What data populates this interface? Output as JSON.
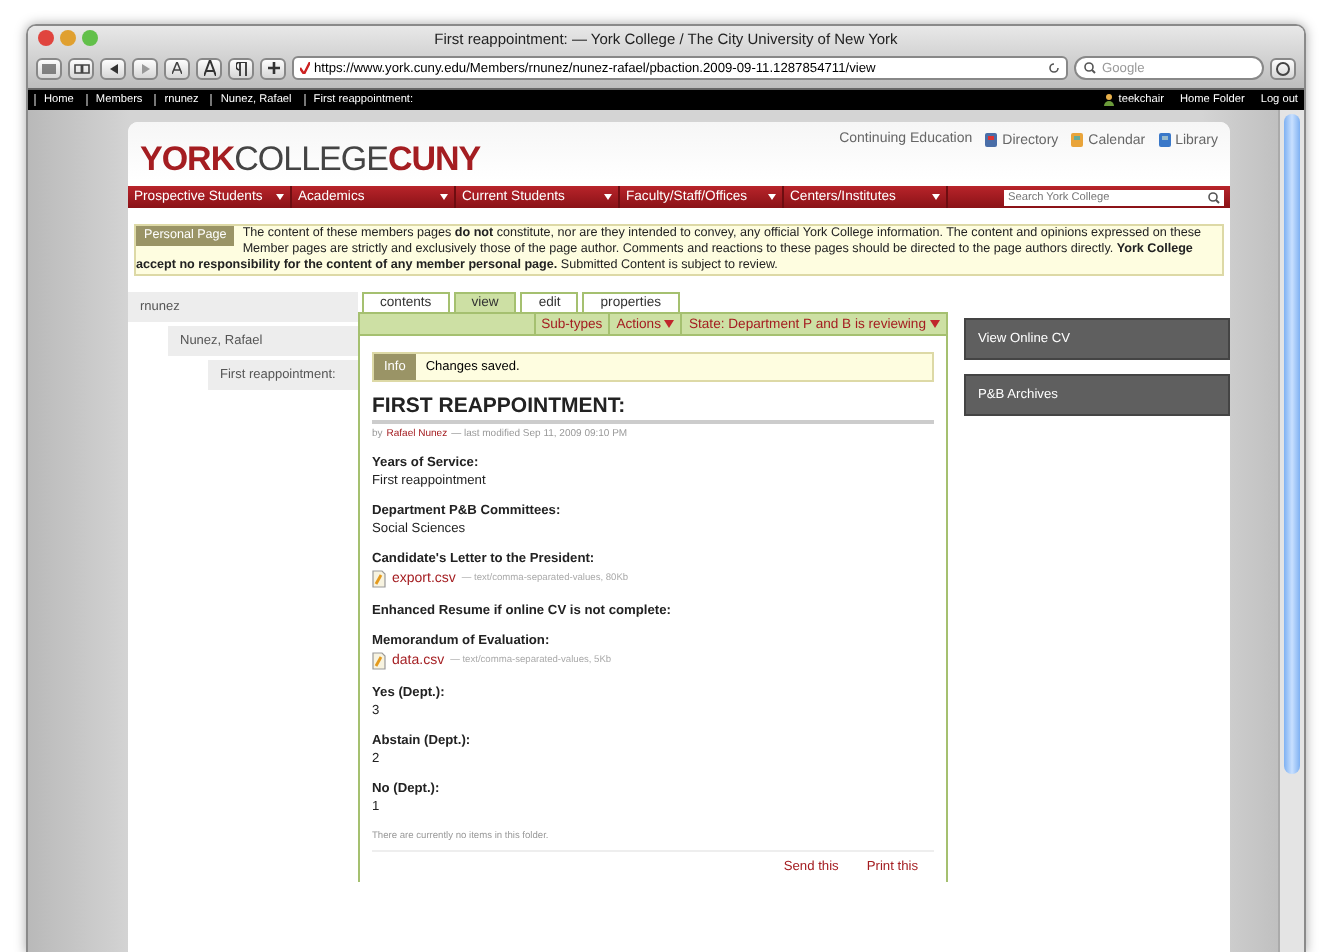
{
  "window": {
    "title": "First reappointment: — York College / The City University of New York"
  },
  "toolbar": {
    "url": "https://www.york.cuny.edu/Members/rnunez/nunez-rafael/pbaction.2009-09-11.1287854711/view",
    "search_placeholder": "Google"
  },
  "breadcrumbs": [
    "Home",
    "Members",
    "rnunez",
    "Nunez, Rafael",
    "First reappointment:"
  ],
  "user_links": [
    "teekchair",
    "Home Folder",
    "Log out"
  ],
  "site": {
    "logo": [
      {
        "text": "YORK",
        "accent": true
      },
      {
        "text": "COLLEGE",
        "accent": false
      },
      {
        "text": "CUNY",
        "accent": true
      }
    ],
    "top_links": [
      {
        "label": "Continuing Education",
        "kind": "plain"
      },
      {
        "label": "Directory",
        "kind": "directory"
      },
      {
        "label": "Calendar",
        "kind": "calendar"
      },
      {
        "label": "Library",
        "kind": "library"
      }
    ],
    "nav": [
      "Prospective Students",
      "Academics",
      "Current Students",
      "Faculty/Staff/Offices",
      "Centers/Institutes"
    ],
    "search_placeholder": "Search York College"
  },
  "notice": {
    "badge": "Personal Page",
    "text": "The content of these members pages **do not** constitute, nor are they intended to convey, any official York College information. The content and opinions expressed on these Member pages are strictly and exclusively those of the page author. Comments and reactions to these pages should be directed to the page authors directly. **York College accept no responsibility for the content of any member personal page.** Submitted Content is subject to review."
  },
  "sidebar": [
    {
      "label": "rnunez",
      "children": [
        {
          "label": "Nunez, Rafael",
          "children": [
            {
              "label": "First reappointment:"
            }
          ]
        }
      ]
    }
  ],
  "tabs": [
    {
      "label": "contents",
      "selected": false
    },
    {
      "label": "view",
      "selected": true
    },
    {
      "label": "edit",
      "selected": false
    },
    {
      "label": "properties",
      "selected": false
    }
  ],
  "actions": [
    {
      "label": "Sub-types",
      "has_menu": false
    },
    {
      "label": "Actions",
      "has_menu": true
    },
    {
      "label": "State: Department P and B is reviewing",
      "has_menu": true
    }
  ],
  "message": {
    "badge": "Info",
    "text": "Changes saved."
  },
  "document": {
    "title": "FIRST REAPPOINTMENT:",
    "by": "by",
    "author": "Rafael Nunez",
    "modified": "— last modified Sep 11, 2009 09:10 PM",
    "fields": [
      {
        "label": "Years of Service:",
        "kind": "text",
        "value": "First reappointment"
      },
      {
        "label": "Department P&B Committees:",
        "kind": "text",
        "value": "Social Sciences"
      },
      {
        "label": "Candidate's Letter to the President:",
        "kind": "file",
        "value": "export.csv",
        "meta": "— text/comma-separated-values, 80Kb"
      },
      {
        "label": "Enhanced Resume if online CV is not complete:",
        "kind": "empty"
      },
      {
        "label": "Memorandum of Evaluation:",
        "kind": "file",
        "value": "data.csv",
        "meta": "— text/comma-separated-values, 5Kb"
      },
      {
        "label": "Yes (Dept.):",
        "kind": "text",
        "value": "3"
      },
      {
        "label": "Abstain (Dept.):",
        "kind": "text",
        "value": "2"
      },
      {
        "label": "No (Dept.):",
        "kind": "text",
        "value": "1"
      }
    ],
    "empty_note": "There are currently no items in this folder.",
    "footer_links": [
      "Send this",
      "Print this"
    ]
  },
  "portlets": [
    "View Online CV",
    "P&B Archives"
  ]
}
